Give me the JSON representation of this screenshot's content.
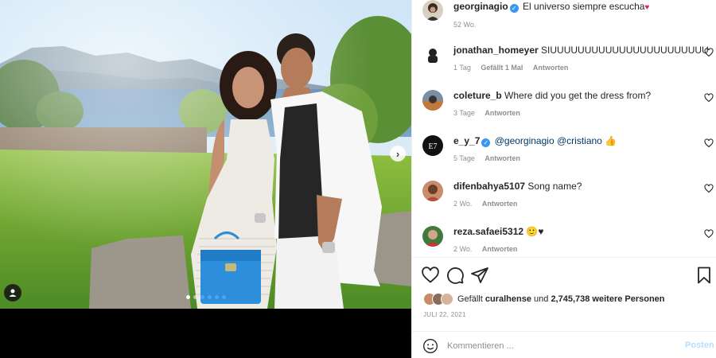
{
  "post": {
    "author": "georginagio",
    "caption": "El universo siempre escucha",
    "caption_emoji": "♥",
    "time": "52 Wo."
  },
  "comments": [
    {
      "user": "jonathan_homeyer",
      "text": "SIUUUUUUUUUUUUUUUUUUUUUUU",
      "time": "1 Tag",
      "likes": "Gefällt 1 Mal",
      "reply": "Antworten"
    },
    {
      "user": "coleture_b",
      "text": "Where did you get the dress from?",
      "time": "3 Tage",
      "reply": "Antworten"
    },
    {
      "user": "e_y_7",
      "mention1": "@georginagio",
      "mention2": "@cristiano",
      "emoji": "👍",
      "time": "5 Tage",
      "reply": "Antworten"
    },
    {
      "user": "difenbahya5107",
      "text": "Song name?",
      "time": "2 Wo.",
      "reply": "Antworten"
    },
    {
      "user": "reza.safaei5312",
      "text": "🙂♥",
      "time": "2 Wo.",
      "reply": "Antworten"
    }
  ],
  "likes": {
    "prefix": "Gefällt",
    "liked_by": "curalhense",
    "connector": "und",
    "others": "2,745,738 weitere Personen"
  },
  "date": "JULI 22, 2021",
  "composer": {
    "placeholder": "Kommentieren ...",
    "post_label": "Posten"
  },
  "carousel": {
    "slides": 6,
    "current": 1
  },
  "icons": {
    "like": "heart-icon",
    "comment": "comment-icon",
    "share": "send-icon",
    "save": "bookmark-icon",
    "emoji": "smiley-icon",
    "next": "chevron-right-icon",
    "tag": "user-tag-icon"
  },
  "colors": {
    "verified": "#3897f0",
    "post_disabled": "#b2dffc",
    "mention": "#00376b",
    "meta": "#8e8e8e"
  }
}
